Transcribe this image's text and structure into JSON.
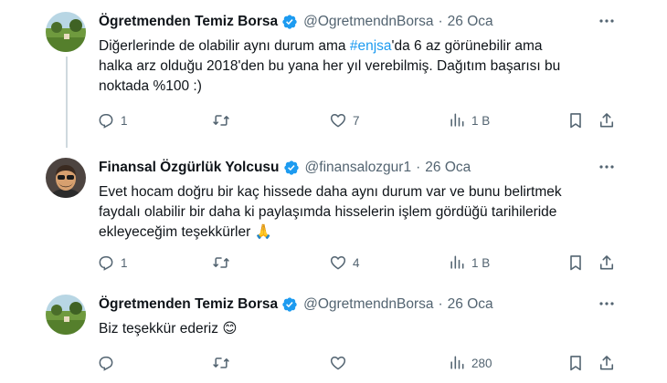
{
  "tweets": [
    {
      "name": "Ögretmenden Temiz Borsa",
      "handle": "@OgretmendnBorsa",
      "separator": "·",
      "date": "26 Oca",
      "lines": [
        {
          "pre": "Diğerlerinde de olabilir aynı durum ama ",
          "hashtag": "#enjsa",
          "post": "'da 6 az görünebilir ama"
        },
        {
          "text": "halka arz olduğu 2018'den bu yana her yıl verebilmiş. Dağıtım başarısı bu"
        },
        {
          "text": "noktada %100 :)"
        }
      ],
      "replies": "1",
      "reposts": "",
      "likes": "7",
      "views": "1 B"
    },
    {
      "name": "Finansal Özgürlük Yolcusu",
      "handle": "@finansalozgur1",
      "separator": "·",
      "date": "26 Oca",
      "lines": [
        {
          "text": "Evet hocam doğru bir kaç hissede daha aynı durum var ve bunu belirtmek"
        },
        {
          "text": "faydalı olabilir bir daha ki paylaşımda hisselerin işlem gördüğü tarihileride"
        },
        {
          "text": "ekleyeceğim teşekkürler",
          "emoji": "🙏"
        }
      ],
      "replies": "1",
      "reposts": "",
      "likes": "4",
      "views": "1 B"
    },
    {
      "name": "Ögretmenden Temiz Borsa",
      "handle": "@OgretmendnBorsa",
      "separator": "·",
      "date": "26 Oca",
      "lines": [
        {
          "text": "Biz teşekkür ederiz",
          "emoji": "😊"
        }
      ],
      "replies": "",
      "reposts": "",
      "likes": "",
      "views": "280"
    }
  ],
  "colors": {
    "accent": "#1d9bf0",
    "verified": "#1d9bf0",
    "secondary_text": "#536471",
    "thread_line": "#cfd9de"
  }
}
